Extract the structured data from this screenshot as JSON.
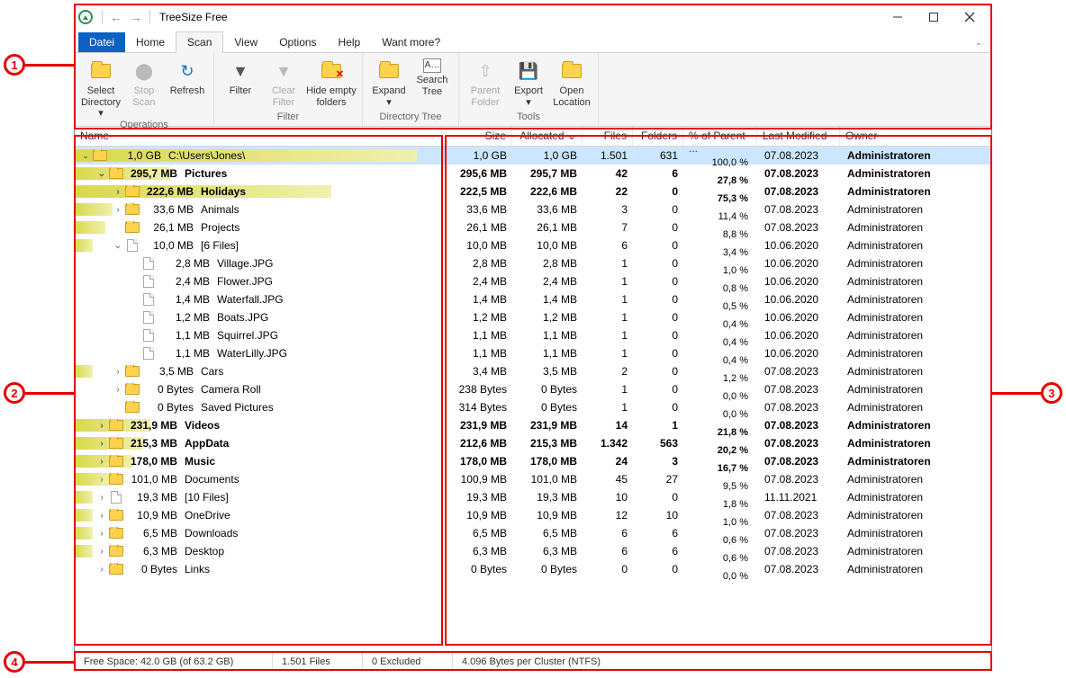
{
  "title": "TreeSize Free",
  "tabs": {
    "file": "Datei",
    "home": "Home",
    "scan": "Scan",
    "view": "View",
    "options": "Options",
    "help": "Help",
    "want": "Want more?"
  },
  "ribbon": {
    "operations": {
      "label": "Operations",
      "select_dir": "Select\nDirectory ▾",
      "stop": "Stop\nScan",
      "refresh": "Refresh"
    },
    "filter": {
      "label": "Filter",
      "filter": "Filter",
      "clear": "Clear\nFilter",
      "hide": "Hide empty\nfolders"
    },
    "dirtree": {
      "label": "Directory Tree",
      "expand": "Expand\n▾",
      "search": "Search\nTree"
    },
    "tools": {
      "label": "Tools",
      "parent": "Parent\nFolder",
      "export": "Export\n▾",
      "openloc": "Open\nLocation"
    }
  },
  "headers": {
    "name": "Name",
    "size": "Size",
    "allocated": "Allocated ⌄",
    "files": "Files",
    "folders": "Folders",
    "pct": "% of Parent ...",
    "modified": "Last Modified",
    "owner": "Owner"
  },
  "rows": [
    {
      "depth": 0,
      "exp": "⌄",
      "type": "folder",
      "bold": false,
      "sel": true,
      "hl": 100,
      "size_t": "1,0 GB",
      "name": "C:\\Users\\Jones\\",
      "size": "1,0 GB",
      "alloc": "1,0 GB",
      "files": "1.501",
      "folders": "631",
      "pct": "100,0 %",
      "pct_w": 100,
      "pct_c": "#1030ff",
      "mod": "07.08.2023",
      "own": "Administratoren",
      "own_b": true
    },
    {
      "depth": 1,
      "exp": "⌄",
      "type": "folder",
      "bold": true,
      "hl": 28,
      "size_t": "295,7 MB",
      "name": "Pictures",
      "size": "295,6 MB",
      "alloc": "295,7 MB",
      "files": "42",
      "folders": "6",
      "pct": "27,8 %",
      "pct_w": 28,
      "pct_c": "#9aa8e8",
      "mod": "07.08.2023",
      "own": "Administratoren",
      "own_b": true
    },
    {
      "depth": 2,
      "exp": "›",
      "type": "folder",
      "bold": true,
      "hl": 75,
      "size_t": "222,6 MB",
      "name": "Holidays",
      "size": "222,5 MB",
      "alloc": "222,6 MB",
      "files": "22",
      "folders": "0",
      "pct": "75,3 %",
      "pct_w": 75,
      "pct_c": "#7a7af0",
      "mod": "07.08.2023",
      "own": "Administratoren",
      "own_b": true
    },
    {
      "depth": 2,
      "exp": "›",
      "type": "folder",
      "bold": false,
      "hl": 11,
      "size_t": "33,6 MB",
      "name": "Animals",
      "size": "33,6 MB",
      "alloc": "33,6 MB",
      "files": "3",
      "folders": "0",
      "pct": "11,4 %",
      "pct_w": 11,
      "pct_c": "#c8c8d8",
      "mod": "07.08.2023",
      "own": "Administratoren"
    },
    {
      "depth": 2,
      "exp": "",
      "type": "folder",
      "bold": false,
      "hl": 9,
      "size_t": "26,1 MB",
      "name": "Projects",
      "size": "26,1 MB",
      "alloc": "26,1 MB",
      "files": "7",
      "folders": "0",
      "pct": "8,8 %",
      "pct_w": 9,
      "pct_c": "#c8c8d8",
      "mod": "07.08.2023",
      "own": "Administratoren"
    },
    {
      "depth": 2,
      "exp": "⌄",
      "type": "file",
      "bold": false,
      "hl": 3,
      "size_t": "10,0 MB",
      "name": "[6 Files]",
      "size": "10,0 MB",
      "alloc": "10,0 MB",
      "files": "6",
      "folders": "0",
      "pct": "3,4 %",
      "pct_w": 3,
      "pct_c": "#c8c8d8",
      "mod": "10.06.2020",
      "own": "Administratoren"
    },
    {
      "depth": 3,
      "exp": "",
      "type": "file",
      "bold": false,
      "hl": 0,
      "size_t": "2,8 MB",
      "name": "Village.JPG",
      "size": "2,8 MB",
      "alloc": "2,8 MB",
      "files": "1",
      "folders": "0",
      "pct": "1,0 %",
      "pct_w": 1,
      "pct_c": "#c8c8d8",
      "mod": "10.06.2020",
      "own": "Administratoren"
    },
    {
      "depth": 3,
      "exp": "",
      "type": "file",
      "bold": false,
      "hl": 0,
      "size_t": "2,4 MB",
      "name": "Flower.JPG",
      "size": "2,4 MB",
      "alloc": "2,4 MB",
      "files": "1",
      "folders": "0",
      "pct": "0,8 %",
      "pct_w": 1,
      "pct_c": "#c8c8d8",
      "mod": "10.06.2020",
      "own": "Administratoren"
    },
    {
      "depth": 3,
      "exp": "",
      "type": "file",
      "bold": false,
      "hl": 0,
      "size_t": "1,4 MB",
      "name": "Waterfall.JPG",
      "size": "1,4 MB",
      "alloc": "1,4 MB",
      "files": "1",
      "folders": "0",
      "pct": "0,5 %",
      "pct_w": 1,
      "pct_c": "#c8c8d8",
      "mod": "10.06.2020",
      "own": "Administratoren"
    },
    {
      "depth": 3,
      "exp": "",
      "type": "file",
      "bold": false,
      "hl": 0,
      "size_t": "1,2 MB",
      "name": "Boats.JPG",
      "size": "1,2 MB",
      "alloc": "1,2 MB",
      "files": "1",
      "folders": "0",
      "pct": "0,4 %",
      "pct_w": 1,
      "pct_c": "#c8c8d8",
      "mod": "10.06.2020",
      "own": "Administratoren"
    },
    {
      "depth": 3,
      "exp": "",
      "type": "file",
      "bold": false,
      "hl": 0,
      "size_t": "1,1 MB",
      "name": "Squirrel.JPG",
      "size": "1,1 MB",
      "alloc": "1,1 MB",
      "files": "1",
      "folders": "0",
      "pct": "0,4 %",
      "pct_w": 1,
      "pct_c": "#c8c8d8",
      "mod": "10.06.2020",
      "own": "Administratoren"
    },
    {
      "depth": 3,
      "exp": "",
      "type": "file",
      "bold": false,
      "hl": 0,
      "size_t": "1,1 MB",
      "name": "WaterLilly.JPG",
      "size": "1,1 MB",
      "alloc": "1,1 MB",
      "files": "1",
      "folders": "0",
      "pct": "0,4 %",
      "pct_w": 1,
      "pct_c": "#c8c8d8",
      "mod": "10.06.2020",
      "own": "Administratoren"
    },
    {
      "depth": 2,
      "exp": "›",
      "type": "folder",
      "bold": false,
      "hl": 1,
      "size_t": "3,5 MB",
      "name": "Cars",
      "size": "3,4 MB",
      "alloc": "3,5 MB",
      "files": "2",
      "folders": "0",
      "pct": "1,2 %",
      "pct_w": 1,
      "pct_c": "#c8c8d8",
      "mod": "07.08.2023",
      "own": "Administratoren"
    },
    {
      "depth": 2,
      "exp": "›",
      "type": "folder",
      "bold": false,
      "hl": 0,
      "size_t": "0 Bytes",
      "name": "Camera Roll",
      "size": "238 Bytes",
      "alloc": "0 Bytes",
      "files": "1",
      "folders": "0",
      "pct": "0,0 %",
      "pct_w": 0,
      "pct_c": "#c8c8d8",
      "mod": "07.08.2023",
      "own": "Administratoren"
    },
    {
      "depth": 2,
      "exp": "",
      "type": "folder",
      "bold": false,
      "hl": 0,
      "size_t": "0 Bytes",
      "name": "Saved Pictures",
      "size": "314 Bytes",
      "alloc": "0 Bytes",
      "files": "1",
      "folders": "0",
      "pct": "0,0 %",
      "pct_w": 0,
      "pct_c": "#c8c8d8",
      "mod": "07.08.2023",
      "own": "Administratoren"
    },
    {
      "depth": 1,
      "exp": "›",
      "type": "folder",
      "bold": true,
      "hl": 22,
      "size_t": "231,9 MB",
      "name": "Videos",
      "size": "231,9 MB",
      "alloc": "231,9 MB",
      "files": "14",
      "folders": "1",
      "pct": "21,8 %",
      "pct_w": 22,
      "pct_c": "#9aa8e8",
      "mod": "07.08.2023",
      "own": "Administratoren",
      "own_b": true
    },
    {
      "depth": 1,
      "exp": "›",
      "type": "folder",
      "bold": true,
      "hl": 20,
      "size_t": "215,3 MB",
      "name": "AppData",
      "size": "212,6 MB",
      "alloc": "215,3 MB",
      "files": "1.342",
      "folders": "563",
      "pct": "20,2 %",
      "pct_w": 20,
      "pct_c": "#9aa8e8",
      "mod": "07.08.2023",
      "own": "Administratoren",
      "own_b": true
    },
    {
      "depth": 1,
      "exp": "›",
      "type": "folder",
      "bold": true,
      "hl": 17,
      "size_t": "178,0 MB",
      "name": "Music",
      "size": "178,0 MB",
      "alloc": "178,0 MB",
      "files": "24",
      "folders": "3",
      "pct": "16,7 %",
      "pct_w": 17,
      "pct_c": "#9aa8e8",
      "mod": "07.08.2023",
      "own": "Administratoren",
      "own_b": true
    },
    {
      "depth": 1,
      "exp": "›",
      "type": "folder",
      "bold": false,
      "hl": 10,
      "size_t": "101,0 MB",
      "name": "Documents",
      "size": "100,9 MB",
      "alloc": "101,0 MB",
      "files": "45",
      "folders": "27",
      "pct": "9,5 %",
      "pct_w": 10,
      "pct_c": "#c8c8d8",
      "mod": "07.08.2023",
      "own": "Administratoren"
    },
    {
      "depth": 1,
      "exp": "›",
      "type": "file",
      "bold": false,
      "hl": 2,
      "size_t": "19,3 MB",
      "name": "[10 Files]",
      "size": "19,3 MB",
      "alloc": "19,3 MB",
      "files": "10",
      "folders": "0",
      "pct": "1,8 %",
      "pct_w": 2,
      "pct_c": "#c8c8d8",
      "mod": "11.11.2021",
      "own": "Administratoren"
    },
    {
      "depth": 1,
      "exp": "›",
      "type": "folder",
      "bold": false,
      "hl": 1,
      "size_t": "10,9 MB",
      "name": "OneDrive",
      "size": "10,9 MB",
      "alloc": "10,9 MB",
      "files": "12",
      "folders": "10",
      "pct": "1,0 %",
      "pct_w": 1,
      "pct_c": "#c8c8d8",
      "mod": "07.08.2023",
      "own": "Administratoren"
    },
    {
      "depth": 1,
      "exp": "›",
      "type": "folder",
      "bold": false,
      "hl": 1,
      "size_t": "6,5 MB",
      "name": "Downloads",
      "size": "6,5 MB",
      "alloc": "6,5 MB",
      "files": "6",
      "folders": "6",
      "pct": "0,6 %",
      "pct_w": 1,
      "pct_c": "#c8c8d8",
      "mod": "07.08.2023",
      "own": "Administratoren"
    },
    {
      "depth": 1,
      "exp": "›",
      "type": "folder",
      "bold": false,
      "hl": 1,
      "size_t": "6,3 MB",
      "name": "Desktop",
      "size": "6,3 MB",
      "alloc": "6,3 MB",
      "files": "6",
      "folders": "6",
      "pct": "0,6 %",
      "pct_w": 1,
      "pct_c": "#c8c8d8",
      "mod": "07.08.2023",
      "own": "Administratoren"
    },
    {
      "depth": 1,
      "exp": "›",
      "type": "folder",
      "bold": false,
      "hl": 0,
      "size_t": "0 Bytes",
      "name": "Links",
      "size": "0 Bytes",
      "alloc": "0 Bytes",
      "files": "0",
      "folders": "0",
      "pct": "0,0 %",
      "pct_w": 0,
      "pct_c": "#c8c8d8",
      "mod": "07.08.2023",
      "own": "Administratoren"
    }
  ],
  "status": {
    "free": "Free Space: 42.0 GB  (of 63.2 GB)",
    "files": "1.501 Files",
    "excl": "0 Excluded",
    "cluster": "4.096 Bytes per Cluster (NTFS)"
  },
  "callouts": {
    "1": "1",
    "2": "2",
    "3": "3",
    "4": "4"
  }
}
